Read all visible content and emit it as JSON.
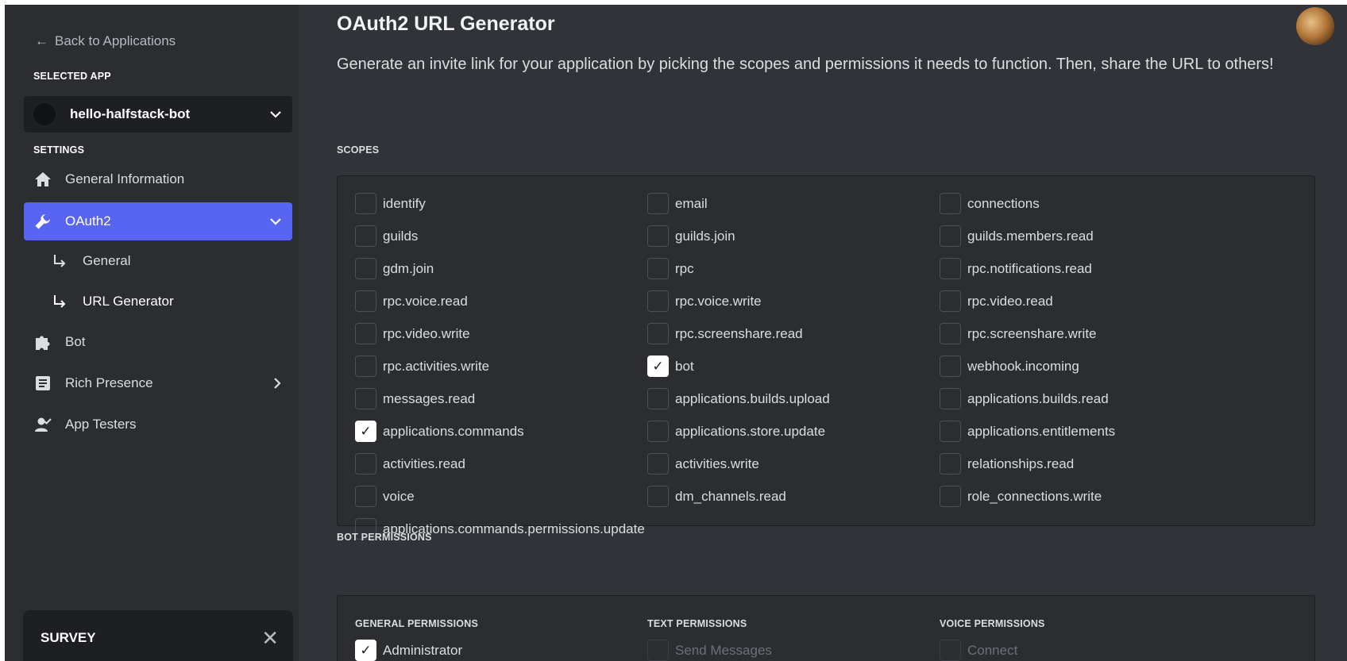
{
  "sidebar": {
    "back_label": "Back to Applications",
    "selected_app_label": "SELECTED APP",
    "app_name": "hello-halfstack-bot",
    "settings_label": "SETTINGS",
    "nav": {
      "general_information": "General Information",
      "oauth2": "OAuth2",
      "oauth2_general": "General",
      "oauth2_url_generator": "URL Generator",
      "bot": "Bot",
      "rich_presence": "Rich Presence",
      "app_testers": "App Testers"
    },
    "survey": "SURVEY"
  },
  "main": {
    "title": "OAuth2 URL Generator",
    "description": "Generate an invite link for your application by picking the scopes and permissions it needs to function. Then, share the URL to others!",
    "scopes_heading": "SCOPES",
    "scopes": [
      {
        "label": "identify",
        "checked": false
      },
      {
        "label": "email",
        "checked": false
      },
      {
        "label": "connections",
        "checked": false
      },
      {
        "label": "guilds",
        "checked": false
      },
      {
        "label": "guilds.join",
        "checked": false
      },
      {
        "label": "guilds.members.read",
        "checked": false
      },
      {
        "label": "gdm.join",
        "checked": false
      },
      {
        "label": "rpc",
        "checked": false
      },
      {
        "label": "rpc.notifications.read",
        "checked": false
      },
      {
        "label": "rpc.voice.read",
        "checked": false
      },
      {
        "label": "rpc.voice.write",
        "checked": false
      },
      {
        "label": "rpc.video.read",
        "checked": false
      },
      {
        "label": "rpc.video.write",
        "checked": false
      },
      {
        "label": "rpc.screenshare.read",
        "checked": false
      },
      {
        "label": "rpc.screenshare.write",
        "checked": false
      },
      {
        "label": "rpc.activities.write",
        "checked": false
      },
      {
        "label": "bot",
        "checked": true
      },
      {
        "label": "webhook.incoming",
        "checked": false
      },
      {
        "label": "messages.read",
        "checked": false
      },
      {
        "label": "applications.builds.upload",
        "checked": false
      },
      {
        "label": "applications.builds.read",
        "checked": false
      },
      {
        "label": "applications.commands",
        "checked": true
      },
      {
        "label": "applications.store.update",
        "checked": false
      },
      {
        "label": "applications.entitlements",
        "checked": false
      },
      {
        "label": "activities.read",
        "checked": false
      },
      {
        "label": "activities.write",
        "checked": false
      },
      {
        "label": "relationships.read",
        "checked": false
      },
      {
        "label": "voice",
        "checked": false
      },
      {
        "label": "dm_channels.read",
        "checked": false
      },
      {
        "label": "role_connections.write",
        "checked": false
      },
      {
        "label": "applications.commands.permissions.update",
        "checked": false
      }
    ],
    "bot_permissions_heading": "BOT PERMISSIONS",
    "general_permissions_heading": "GENERAL PERMISSIONS",
    "text_permissions_heading": "TEXT PERMISSIONS",
    "voice_permissions_heading": "VOICE PERMISSIONS",
    "general_permissions": [
      {
        "label": "Administrator",
        "checked": true,
        "disabled": false
      }
    ],
    "text_permissions": [
      {
        "label": "Send Messages",
        "checked": false,
        "disabled": true
      }
    ],
    "voice_permissions": [
      {
        "label": "Connect",
        "checked": false,
        "disabled": true
      }
    ]
  },
  "colors": {
    "accent": "#5865f2",
    "sidebar_bg": "#2b2d31",
    "main_bg": "#313338",
    "box_bg": "#2b2d31"
  }
}
